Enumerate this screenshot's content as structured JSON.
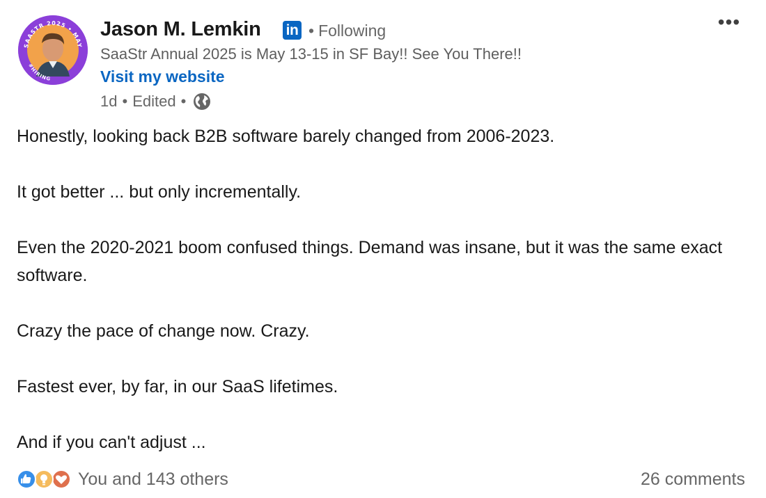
{
  "post": {
    "author": {
      "name": "Jason M. Lemkin",
      "badge_text": "in",
      "follow_status": "Following",
      "headline": "SaaStr Annual 2025 is May 13-15 in SF Bay!! See You There!!",
      "website_link": "Visit my website",
      "avatar_ring_text_top": "SAASTR 2025 • MAY",
      "avatar_ring_text_bottom": "#HIRING"
    },
    "meta": {
      "age": "1d",
      "edited": "Edited",
      "separator": "•",
      "visibility_icon": "globe-icon"
    },
    "more_icon": "•••",
    "body": [
      "Honestly, looking back B2B software barely changed from 2006-2023.",
      "It got better ... but only incrementally.",
      "Even the 2020-2021 boom confused things. Demand was insane, but it was the same exact software.",
      "Crazy the pace of change now. Crazy.",
      "Fastest ever, by far, in our SaaS lifetimes.",
      "And if you can't adjust ..."
    ],
    "footer": {
      "reaction_icons": [
        "like-icon",
        "insightful-icon",
        "love-icon"
      ],
      "reactions_text": "You and 143 others",
      "comments_text": "26 comments"
    }
  },
  "colors": {
    "linkedin_blue": "#0a66c2",
    "avatar_ring": "#8b3fd9",
    "secondary_text": "#666666",
    "like": "#378fe9",
    "insightful": "#f5bb5c",
    "love": "#df704d"
  }
}
